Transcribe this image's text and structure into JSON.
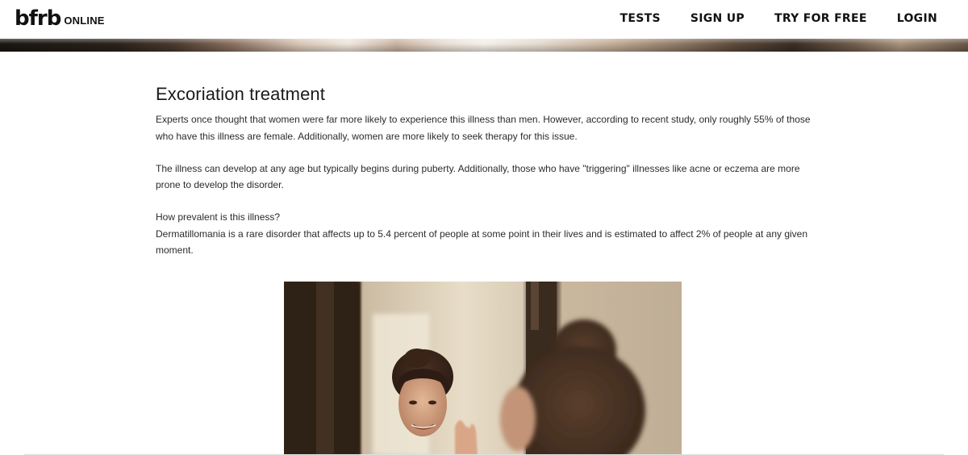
{
  "header": {
    "logo_text": "bfrb",
    "logo_sub": "ONLINE",
    "nav": [
      {
        "label": "TESTS"
      },
      {
        "label": "SIGN UP"
      },
      {
        "label": "TRY FOR FREE"
      },
      {
        "label": "LOGIN"
      }
    ]
  },
  "article": {
    "title": "Excoriation treatment",
    "paragraphs": [
      "Experts once thought that women were far more likely to experience this illness than men. However, according to recent study, only roughly 55% of those who have this illness are female. Additionally, women are more likely to seek therapy for this issue.",
      "The illness can develop at any age but typically begins during puberty. Additionally, those who have \"triggering\" illnesses like acne or eczema are more prone to develop the disorder."
    ],
    "question": "How prevalent is this illness?",
    "answer": "Dermatillomania is a rare disorder that affects up to 5.4 percent of people at some point in their lives and is estimated to affect 2% of people at any given moment."
  },
  "colors": {
    "text": "#2b2b2b",
    "nav": "#111111",
    "background": "#ffffff"
  }
}
